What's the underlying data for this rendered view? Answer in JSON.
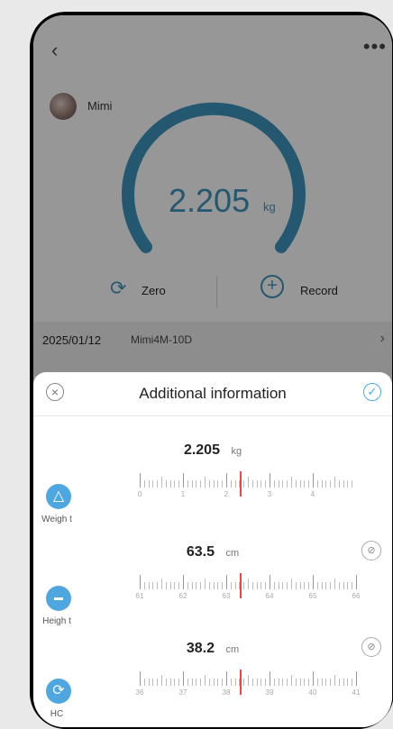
{
  "header": {
    "back_icon": "chevron-left-icon",
    "more_icon": "more-icon"
  },
  "user": {
    "name": "Mimi"
  },
  "gauge": {
    "value": "2.205",
    "unit": "kg",
    "color": "#3a8fb7"
  },
  "actions": {
    "zero_label": "Zero",
    "record_label": "Record"
  },
  "history": {
    "date": "2025/01/12",
    "device": "Mimi4M-10D"
  },
  "sheet": {
    "title": "Additional information",
    "accent": "#4ea8df",
    "rows": [
      {
        "label": "Weigh t",
        "value": "2.205",
        "unit": "kg",
        "ticks": [
          "0",
          "1",
          "2",
          "3",
          "4"
        ],
        "icon": "weight-icon"
      },
      {
        "label": "Heigh t",
        "value": "63.5",
        "unit": "cm",
        "ticks": [
          "61",
          "62",
          "63",
          "64",
          "65",
          "66"
        ],
        "icon": "ruler-icon"
      },
      {
        "label": "HC",
        "value": "38.2",
        "unit": "cm",
        "ticks": [
          "36",
          "37",
          "38",
          "39",
          "40",
          "41"
        ],
        "icon": "head-circumference-icon"
      }
    ]
  }
}
